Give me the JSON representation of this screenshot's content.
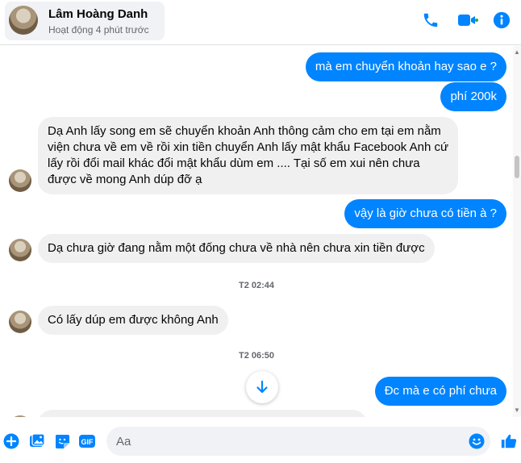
{
  "header": {
    "contact_name": "Lâm Hoàng Danh",
    "status": "Hoạt động 4 phút trước",
    "accent_color": "#0084ff"
  },
  "messages": [
    {
      "direction": "outgoing",
      "text": "mà em chuyển khoản hay sao e ?"
    },
    {
      "direction": "outgoing",
      "text": "phí 200k"
    },
    {
      "direction": "incoming",
      "lines": [
        "Dạ Anh lấy song em sẽ chuyển khoản Anh thông cảm cho em tại em nằm",
        "viện chưa về em về rồi xin tiền chuyển Anh lấy mật khẩu Facebook Anh cứ",
        "lấy rồi đổi mail khác đổi mật khẩu dùm em .... Tại số em xui nên chưa",
        "được về mong Anh dúp đỡ ạ"
      ]
    },
    {
      "direction": "outgoing",
      "text": "vậy là giờ chưa có tiền à ?"
    },
    {
      "direction": "incoming",
      "text": "Dạ chưa giờ đang nằm một đống chưa về nhà nên chưa xin tiền được"
    },
    {
      "type": "timestamp",
      "text": "T2 02:44"
    },
    {
      "direction": "incoming",
      "text": "Có lấy dúp em được không Anh"
    },
    {
      "type": "timestamp",
      "text": "T2 06:50"
    },
    {
      "direction": "outgoing",
      "text": "Đc mà e có phí chưa"
    }
  ],
  "composer": {
    "placeholder": "Aa",
    "icons": [
      "plus-circle-icon",
      "photo-icon",
      "sticker-icon",
      "gif-icon",
      "emoji-icon",
      "like-icon"
    ],
    "gif_label": "GIF"
  }
}
